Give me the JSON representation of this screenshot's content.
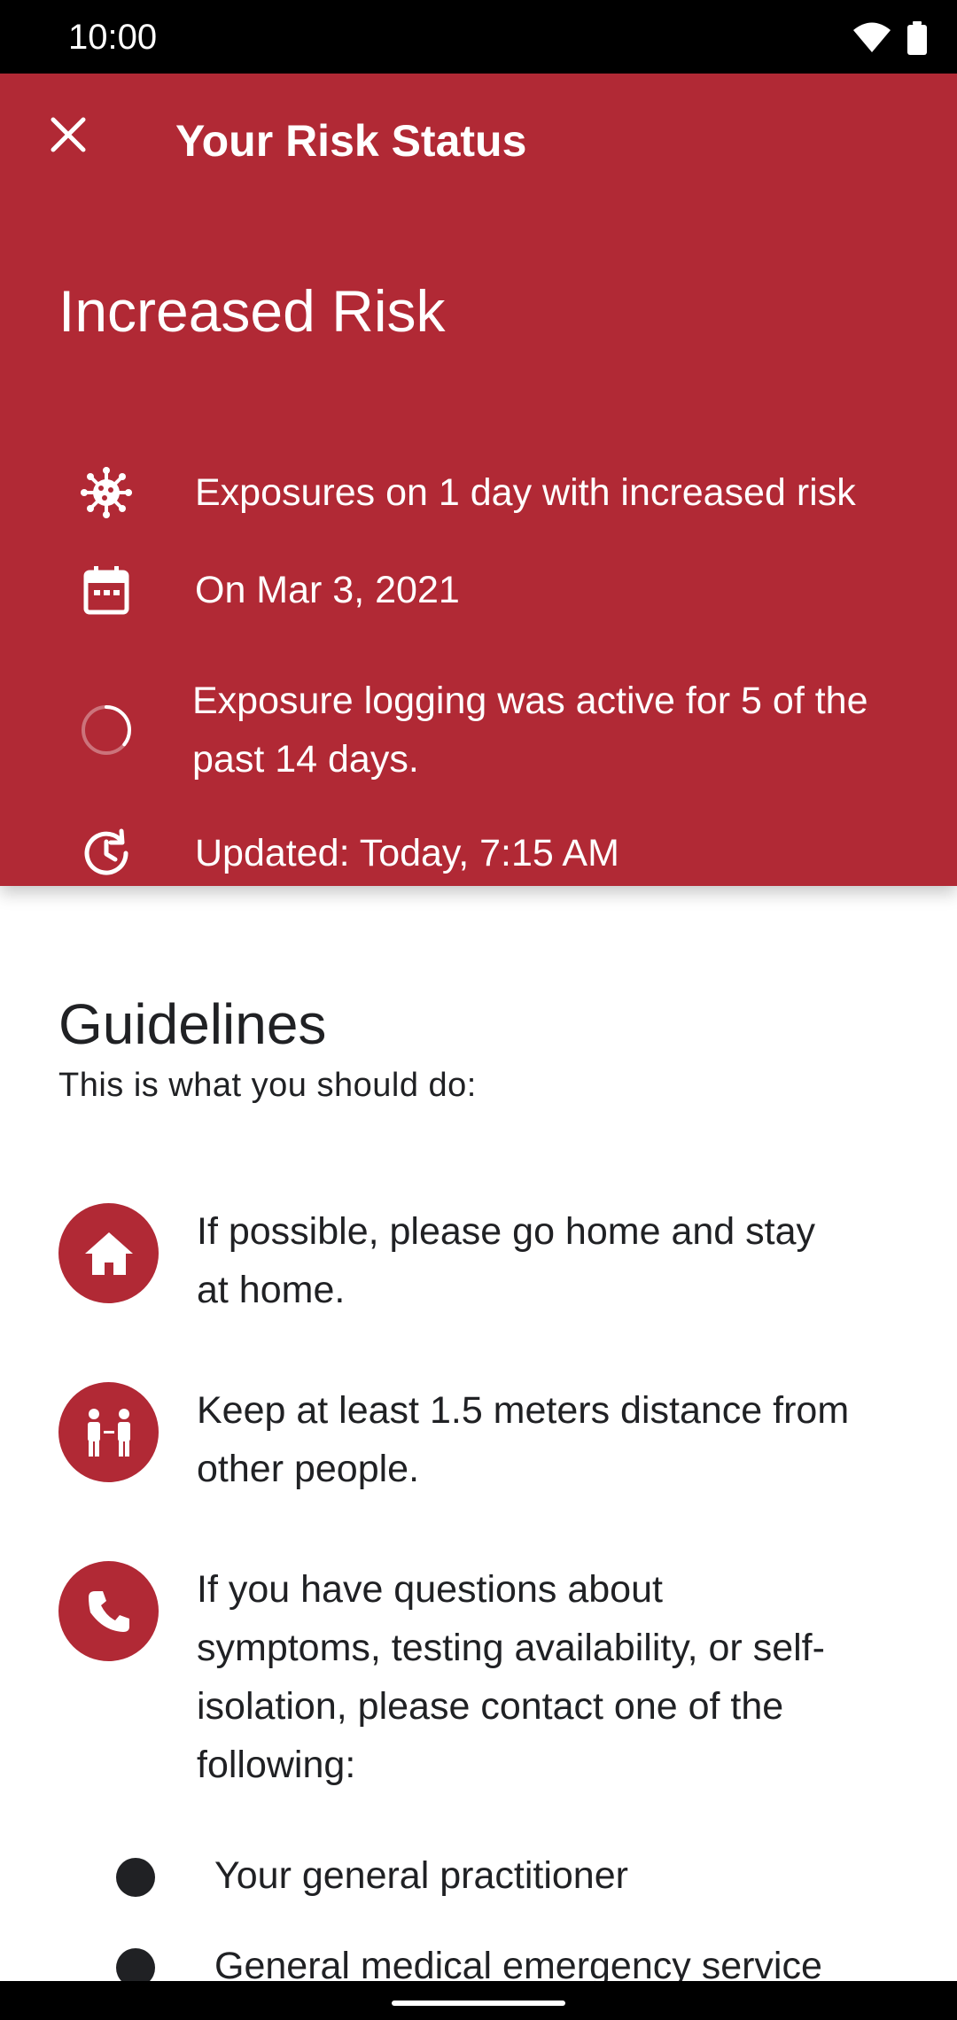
{
  "status_bar": {
    "time": "10:00",
    "wifi_icon": "wifi-icon",
    "battery_icon": "battery-icon"
  },
  "colors": {
    "header_bg": "#b12935",
    "accent": "#b12935",
    "text_dark": "#202124"
  },
  "toolbar": {
    "close_icon": "close-icon",
    "title": "Your Risk Status"
  },
  "risk": {
    "title": "Increased Risk",
    "rows": [
      {
        "icon": "virus-icon",
        "text": "Exposures on 1 day with increased risk"
      },
      {
        "icon": "calendar-icon",
        "text": "On Mar 3, 2021"
      },
      {
        "icon": "progress-ring-icon",
        "text": "Exposure logging was active for 5 of the past 14 days.",
        "progress": "5/14"
      },
      {
        "icon": "history-clock-icon",
        "text": "Updated: Today, 7:15 AM"
      }
    ]
  },
  "guidelines": {
    "title": "Guidelines",
    "subtitle": "This is what you should do:",
    "items": [
      {
        "icon": "home-icon",
        "text": "If possible, please go home and stay at home."
      },
      {
        "icon": "social-distance-icon",
        "text": "Keep at least 1.5 meters distance from other people."
      },
      {
        "icon": "phone-icon",
        "text": "If you have questions about symptoms, testing availability, or self-isolation, please contact one of the following:"
      }
    ],
    "contacts": [
      "Your general practitioner",
      "General medical emergency service"
    ]
  }
}
